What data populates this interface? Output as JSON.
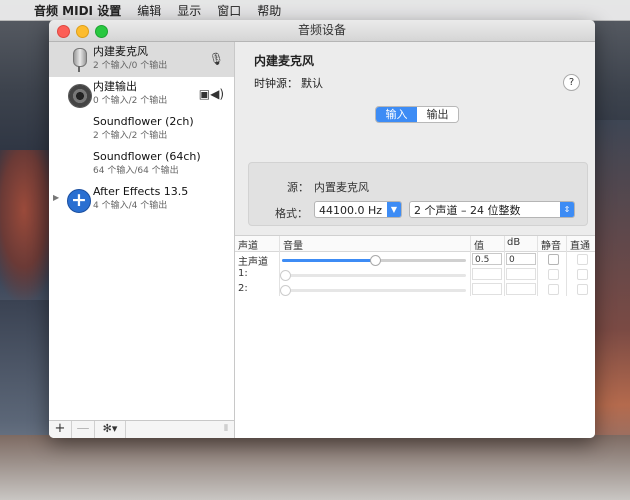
{
  "menubar": {
    "apple": "",
    "items": [
      "音频 MIDI 设置",
      "编辑",
      "显示",
      "窗口",
      "帮助"
    ]
  },
  "window": {
    "title": "音频设备"
  },
  "devices": [
    {
      "name": "内建麦克风",
      "sub": "2 个输入/0 个输出",
      "icon": "microphone-icon",
      "right_icon": "🎙"
    },
    {
      "name": "内建输出",
      "sub": "0 个输入/2 个输出",
      "icon": "speaker-icon",
      "right_icon": "▣◀)"
    },
    {
      "name": "Soundflower (2ch)",
      "sub": "2 个输入/2 个输出",
      "icon": ""
    },
    {
      "name": "Soundflower (64ch)",
      "sub": "64 个输入/64 个输出",
      "icon": ""
    },
    {
      "name": "After Effects 13.5",
      "sub": "4 个输入/4 个输出",
      "icon": "after-effects-icon",
      "icon_glyph": "+"
    }
  ],
  "sidebar_toolbar": {
    "add": "+",
    "remove": "—",
    "gear": "✻▾",
    "grip": "⦀"
  },
  "main": {
    "device_title": "内建麦克风",
    "clock_label": "时钟源：",
    "clock_value": "默认",
    "help": "?",
    "tabs": [
      "输入",
      "输出"
    ],
    "active_tab": "输入",
    "source_label": "源：",
    "source_value": "内置麦克风",
    "format_label": "格式：",
    "sample_rate": "44100.0 Hz",
    "bit_format": "2 个声道 – 24 位整数"
  },
  "table": {
    "headers": [
      "声道",
      "音量",
      "值",
      "dB",
      "静音",
      "直通"
    ],
    "rows": [
      {
        "channel": "主声道",
        "volume": 0.5,
        "value": "0.5",
        "db": "0",
        "enabled": true
      },
      {
        "channel": "1:",
        "volume": 0.0,
        "value": "",
        "db": "",
        "enabled": false
      },
      {
        "channel": "2:",
        "volume": 0.0,
        "value": "",
        "db": "",
        "enabled": false
      }
    ]
  },
  "colors": {
    "accent": "#3d8cf5",
    "selection": "#dcdcdc"
  }
}
